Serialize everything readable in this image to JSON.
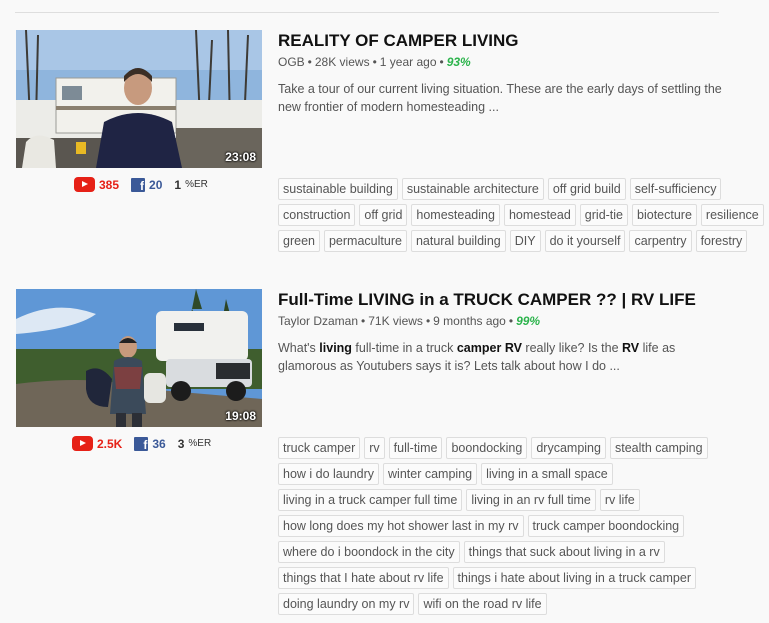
{
  "colors": {
    "youtube_red": "#e62117",
    "facebook_blue": "#3b5998",
    "rating_green": "#2bb34b"
  },
  "results": [
    {
      "title": "REALITY OF CAMPER LIVING",
      "channel": "OGB",
      "views": "28K views",
      "age": "1 year ago",
      "rating": "93%",
      "description": "Take a tour of our current living situation. These are the early days of settling the new frontier of modern homesteading ...",
      "duration": "23:08",
      "youtube_count": "385",
      "facebook_count": "20",
      "er_value": "1",
      "er_label": "%ER",
      "tags": [
        "sustainable building",
        "sustainable architecture",
        "off grid build",
        "self-sufficiency",
        "construction",
        "off grid",
        "homesteading",
        "homestead",
        "grid-tie",
        "biotecture",
        "resilience",
        "green",
        "permaculture",
        "natural building",
        "DIY",
        "do it yourself",
        "carpentry",
        "forestry"
      ]
    },
    {
      "title": "Full-Time LIVING in a TRUCK CAMPER ?? | RV LIFE",
      "channel": "Taylor Dzaman",
      "views": "71K views",
      "age": "9 months ago",
      "rating": "99%",
      "description_parts": [
        "What's ",
        "living",
        " full-time in a truck ",
        "camper",
        " ",
        "RV",
        " really like? Is the ",
        "RV",
        " life as glamorous as Youtubers says it is? Lets talk about how I do ..."
      ],
      "duration": "19:08",
      "youtube_count": "2.5K",
      "facebook_count": "36",
      "er_value": "3",
      "er_label": "%ER",
      "tags": [
        "truck camper",
        "rv",
        "full-time",
        "boondocking",
        "drycamping",
        "stealth camping",
        "how i do laundry",
        "winter camping",
        "living in a small space",
        "living in a truck camper full time",
        "living in an rv full time",
        "rv life",
        "how long does my hot shower last in my rv",
        "truck camper boondocking",
        "where do i boondock in the city",
        "things that suck about living in a rv",
        "things that I hate about rv life",
        "things i hate about living in a truck camper",
        "doing laundry on my rv",
        "wifi on the road rv life"
      ]
    }
  ]
}
